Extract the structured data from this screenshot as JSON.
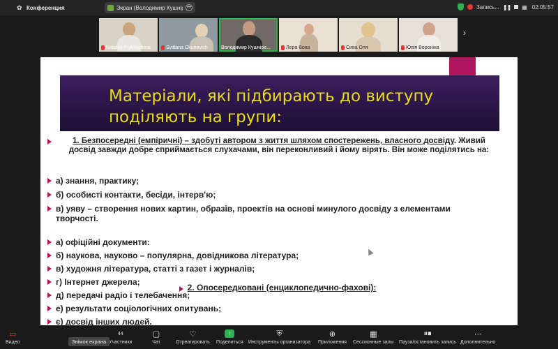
{
  "topbar": {
    "app_title": "Конференция",
    "share_label": "Экран (Володимир Кушніреі",
    "recording": "Запись...",
    "time": "02:05:57"
  },
  "participants": [
    {
      "name": "Nataliia Prykhodkina",
      "muted": true
    },
    {
      "name": "Svitlana Okunevich",
      "muted": true
    },
    {
      "name": "Володимир Кушніре...",
      "muted": false
    },
    {
      "name": "Лера Вова",
      "muted": true
    },
    {
      "name": "Сива Оля",
      "muted": true
    },
    {
      "name": "Юлія Вороніна",
      "muted": true
    }
  ],
  "slide": {
    "title": "Матеріали, які підбирають до виступу поділяють на групи:",
    "heading1_underlined": "1. Безпосередні (емпіричні) – здобуті автором з життя шляхом спостережень, власного досвіду",
    "heading1_rest": ". Живий досвід завжди добре сприймається слухачами, він переконливий і йому вірять. Він може поділятись на:",
    "group1": [
      "а) знання, практику;",
      "б) особисті контакти, бесіди, інтерв'ю;",
      "в) уяву – створення нових картин, образів, проектів на основі минулого досвіду з елементами творчості."
    ],
    "heading2": "2. Опосередковані (енциклопедично-фахові):",
    "group2": [
      "а) офіційні документи:",
      "б) наукова, науково – популярна, довідникова література;",
      "в) художня література, статті з газет і журналів;",
      "г) Інтернет джерела;",
      "д) передачі радіо і телебачення;",
      "е) результати соціологічних опитувань;",
      "є) досвід інших людей."
    ]
  },
  "toolbar": {
    "items": [
      {
        "label": "Видео",
        "icon": "video-off-icon"
      },
      {
        "label": "Участники",
        "icon": "participants-icon",
        "count": "44"
      },
      {
        "label": "Чат",
        "icon": "chat-icon"
      },
      {
        "label": "Отреагировать",
        "icon": "heart-icon"
      },
      {
        "label": "Поделиться",
        "icon": "share-icon"
      },
      {
        "label": "Инструменты организатора",
        "icon": "shield-icon"
      },
      {
        "label": "Приложения",
        "icon": "apps-icon"
      },
      {
        "label": "Сессионные залы",
        "icon": "breakout-icon"
      },
      {
        "label": "Пауза/остановить запись",
        "icon": "pause-record-icon"
      },
      {
        "label": "Дополнительно",
        "icon": "more-icon"
      }
    ],
    "tooltip": "Знімок екрана"
  }
}
